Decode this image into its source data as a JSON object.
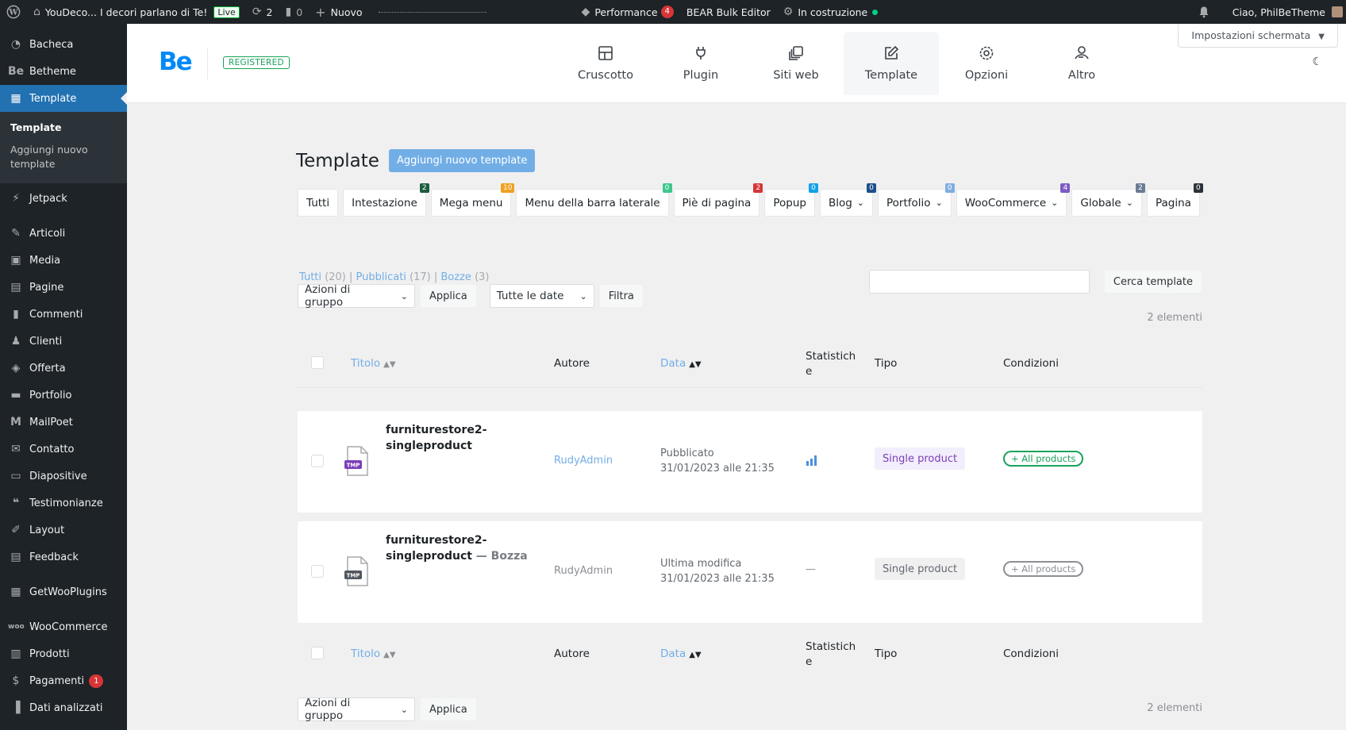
{
  "adminbar": {
    "site_name": "YouDeco... I decori parlano di Te!",
    "live": "Live",
    "updates": "2",
    "comments": "0",
    "new": "Nuovo",
    "performance": "Performance",
    "performance_count": "4",
    "bear": "BEAR Bulk Editor",
    "status": "In costruzione",
    "greeting": "Ciao, PhilBeTheme"
  },
  "sidebar": {
    "items": [
      {
        "label": "Bacheca",
        "icon": "dashboard-icon"
      },
      {
        "label": "Betheme",
        "icon": "betheme-icon"
      },
      {
        "label": "Template",
        "icon": "template-icon"
      },
      {
        "label": "Jetpack",
        "icon": "jetpack-icon"
      },
      {
        "label": "Articoli",
        "icon": "pin-icon"
      },
      {
        "label": "Media",
        "icon": "media-icon"
      },
      {
        "label": "Pagine",
        "icon": "page-icon"
      },
      {
        "label": "Commenti",
        "icon": "comment-icon"
      },
      {
        "label": "Clienti",
        "icon": "user-icon"
      },
      {
        "label": "Offerta",
        "icon": "tag-icon"
      },
      {
        "label": "Portfolio",
        "icon": "folder-icon"
      },
      {
        "label": "MailPoet",
        "icon": "mailpoet-icon"
      },
      {
        "label": "Contatto",
        "icon": "mail-icon"
      },
      {
        "label": "Diapositive",
        "icon": "slides-icon"
      },
      {
        "label": "Testimonianze",
        "icon": "quote-icon"
      },
      {
        "label": "Layout",
        "icon": "pencil-icon"
      },
      {
        "label": "Feedback",
        "icon": "feedback-icon"
      },
      {
        "label": "GetWooPlugins",
        "icon": "plugin-icon"
      },
      {
        "label": "WooCommerce",
        "icon": "woo-icon"
      },
      {
        "label": "Prodotti",
        "icon": "archive-icon"
      },
      {
        "label": "Pagamenti",
        "icon": "payment-icon",
        "badge": "1"
      },
      {
        "label": "Dati analizzati",
        "icon": "chart-icon"
      }
    ],
    "submenu": [
      "Template",
      "Aggiungi nuovo template"
    ]
  },
  "header": {
    "logo": "Be",
    "registered": "REGISTERED",
    "tabs": [
      {
        "label": "Cruscotto",
        "icon": "grid-icon"
      },
      {
        "label": "Plugin",
        "icon": "plug-icon"
      },
      {
        "label": "Siti web",
        "icon": "websites-icon"
      },
      {
        "label": "Template",
        "icon": "edit-icon"
      },
      {
        "label": "Opzioni",
        "icon": "gear-icon"
      },
      {
        "label": "Altro",
        "icon": "support-icon"
      }
    ],
    "screen_options": "Impostazioni schermata"
  },
  "main": {
    "title": "Template",
    "add_new": "Aggiungi nuovo template",
    "filters": [
      {
        "label": "Tutti"
      },
      {
        "label": "Intestazione",
        "count": "2",
        "color": "#1f5c3e"
      },
      {
        "label": "Mega menu",
        "count": "10",
        "color": "#f0a122"
      },
      {
        "label": "Menu della barra laterale",
        "count": "0",
        "color": "#3cc88a"
      },
      {
        "label": "Piè di pagina",
        "count": "2",
        "color": "#d63638"
      },
      {
        "label": "Popup",
        "count": "0",
        "color": "#13a2e8"
      },
      {
        "label": "Blog",
        "count": "0",
        "color": "#1e4f8a",
        "dropdown": true
      },
      {
        "label": "Portfolio",
        "count": "0",
        "color": "#7faee0",
        "dropdown": true
      },
      {
        "label": "WooCommerce",
        "count": "4",
        "color": "#7c5cc4",
        "dropdown": true
      },
      {
        "label": "Globale",
        "count": "2",
        "color": "#6b7b95",
        "dropdown": true
      },
      {
        "label": "Pagina",
        "count": "0",
        "color": "#2c3338"
      }
    ],
    "views": [
      {
        "label": "Tutti",
        "count": "(20)"
      },
      {
        "label": "Pubblicati",
        "count": "(17)"
      },
      {
        "label": "Bozze",
        "count": "(3)"
      }
    ],
    "search_button": "Cerca template",
    "bulk_actions": "Azioni di gruppo",
    "apply": "Applica",
    "all_dates": "Tutte le date",
    "filter": "Filtra",
    "items_count": "2 elementi",
    "columns": {
      "title": "Titolo",
      "author": "Autore",
      "date": "Data",
      "stats_line1": "Statistich",
      "stats_line2": "e",
      "type": "Tipo",
      "conditions": "Condizioni"
    },
    "rows": [
      {
        "title_line1": "furniturestore2-",
        "title_line2": "singleproduct",
        "draft": "",
        "author": "RudyAdmin",
        "date_status": "Pubblicato",
        "date_value": "31/01/2023 alle 21:35",
        "stats": "",
        "type": "Single product",
        "condition": "+ All products",
        "icon_badge": "TMP",
        "icon_badge_color": "#7c3fb8"
      },
      {
        "title_line1": "furniturestore2-",
        "title_line2": "singleproduct",
        "draft": " — Bozza",
        "author": "RudyAdmin",
        "date_status": "Ultima modifica",
        "date_value": "31/01/2023 alle 21:35",
        "stats": "—",
        "type": "Single product",
        "condition": "+ All products",
        "icon_badge": "TMP",
        "icon_badge_color": "#50575e"
      }
    ]
  }
}
